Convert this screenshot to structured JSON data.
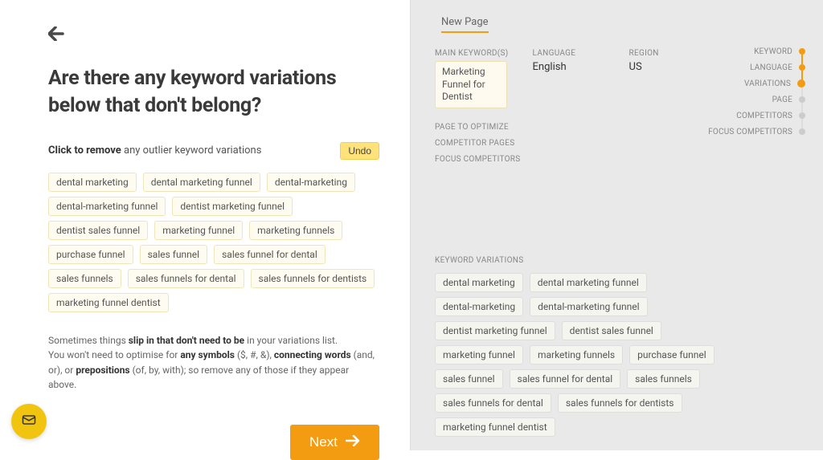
{
  "heading": "Are there any keyword variations below that don't belong?",
  "subheading_bold": "Click to remove",
  "subheading_rest": " any outlier keyword variations",
  "undo_label": "Undo",
  "chips": [
    "dental marketing",
    "dental marketing funnel",
    "dental-marketing",
    "dental-marketing funnel",
    "dentist marketing funnel",
    "dentist sales funnel",
    "marketing funnel",
    "marketing funnels",
    "purchase funnel",
    "sales funnel",
    "sales funnel for dental",
    "sales funnels",
    "sales funnels for dental",
    "sales funnels for dentists",
    "marketing funnel dentist"
  ],
  "hint": {
    "l1a": "Sometimes things ",
    "l1b": "slip in that don't need to be",
    "l1c": " in your variations list.",
    "l2a": "You won't need to optimise for ",
    "l2b": "any symbols",
    "l2c": " ($, #, &), ",
    "l2d": "connecting words",
    "l2e": " (and, or), or ",
    "l2f": "prepositions",
    "l2g": " (of, by, with); so remove any of those if they appear above."
  },
  "next_label": "Next",
  "page_tab": "New Page",
  "summary": {
    "main_keyword_label": "MAIN KEYWORD(S)",
    "main_keyword_value": "Marketing Funnel for Dentist",
    "language_label": "LANGUAGE",
    "language_value": "English",
    "region_label": "REGION",
    "region_value": "US",
    "links": [
      "PAGE TO OPTIMIZE",
      "COMPETITOR PAGES",
      "FOCUS COMPETITORS"
    ]
  },
  "kv_label": "KEYWORD VARIATIONS",
  "kv_chips": [
    "dental marketing",
    "dental marketing funnel",
    "dental-marketing",
    "dental-marketing funnel",
    "dentist marketing funnel",
    "dentist sales funnel",
    "marketing funnel",
    "marketing funnels",
    "purchase funnel",
    "sales funnel",
    "sales funnel for dental",
    "sales funnels",
    "sales funnels for dental",
    "sales funnels for dentists",
    "marketing funnel dentist"
  ],
  "steps": [
    {
      "label": "KEYWORD",
      "state": "done"
    },
    {
      "label": "LANGUAGE",
      "state": "done"
    },
    {
      "label": "VARIATIONS",
      "state": "active"
    },
    {
      "label": "PAGE",
      "state": "pending"
    },
    {
      "label": "COMPETITORS",
      "state": "pending"
    },
    {
      "label": "FOCUS COMPETITORS",
      "state": "pending"
    }
  ]
}
